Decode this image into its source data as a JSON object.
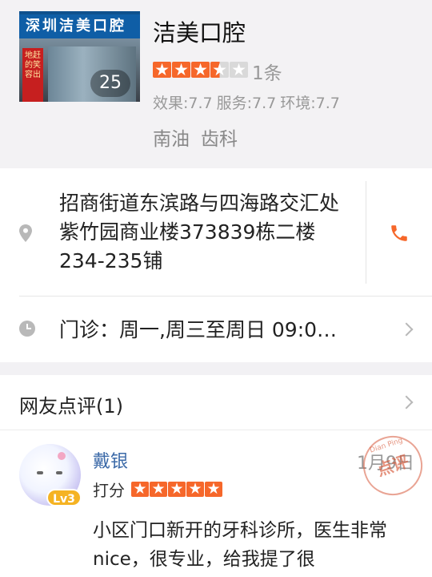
{
  "shop": {
    "thumbnail": {
      "sign_text": "深圳洁美口腔",
      "banner_text": "地赶的笑容出",
      "photo_count": "25"
    },
    "name": "洁美口腔",
    "rating": {
      "stars": 3.5,
      "max": 5
    },
    "review_count": "1条",
    "scores": {
      "effect": "效果:7.7",
      "service": "服务:7.7",
      "environment": "环境:7.7"
    },
    "tags": [
      "南油",
      "齿科"
    ]
  },
  "info": {
    "address": "招商街道东滨路与四海路交汇处紫竹园商业楼373839栋二楼234-235铺",
    "hours": "门诊：周一,周三至周日 09:0…",
    "icons": {
      "location": "location-pin-icon",
      "phone": "phone-icon",
      "clock": "clock-icon"
    }
  },
  "reviews": {
    "title": "网友点评(1)",
    "items": [
      {
        "user": "戴银",
        "level": "Lv3",
        "date": "1月9日",
        "rating_label": "打分",
        "stars": 5,
        "stamp": {
          "top": "Dian Ping",
          "main": "点评"
        },
        "text": "小区门口新开的牙科诊所，医生非常nice，很专业，给我提了很"
      }
    ]
  },
  "colors": {
    "accent": "#f6672a",
    "link": "#3c6aa8",
    "muted": "#999999",
    "level_badge": "#f5b323"
  }
}
